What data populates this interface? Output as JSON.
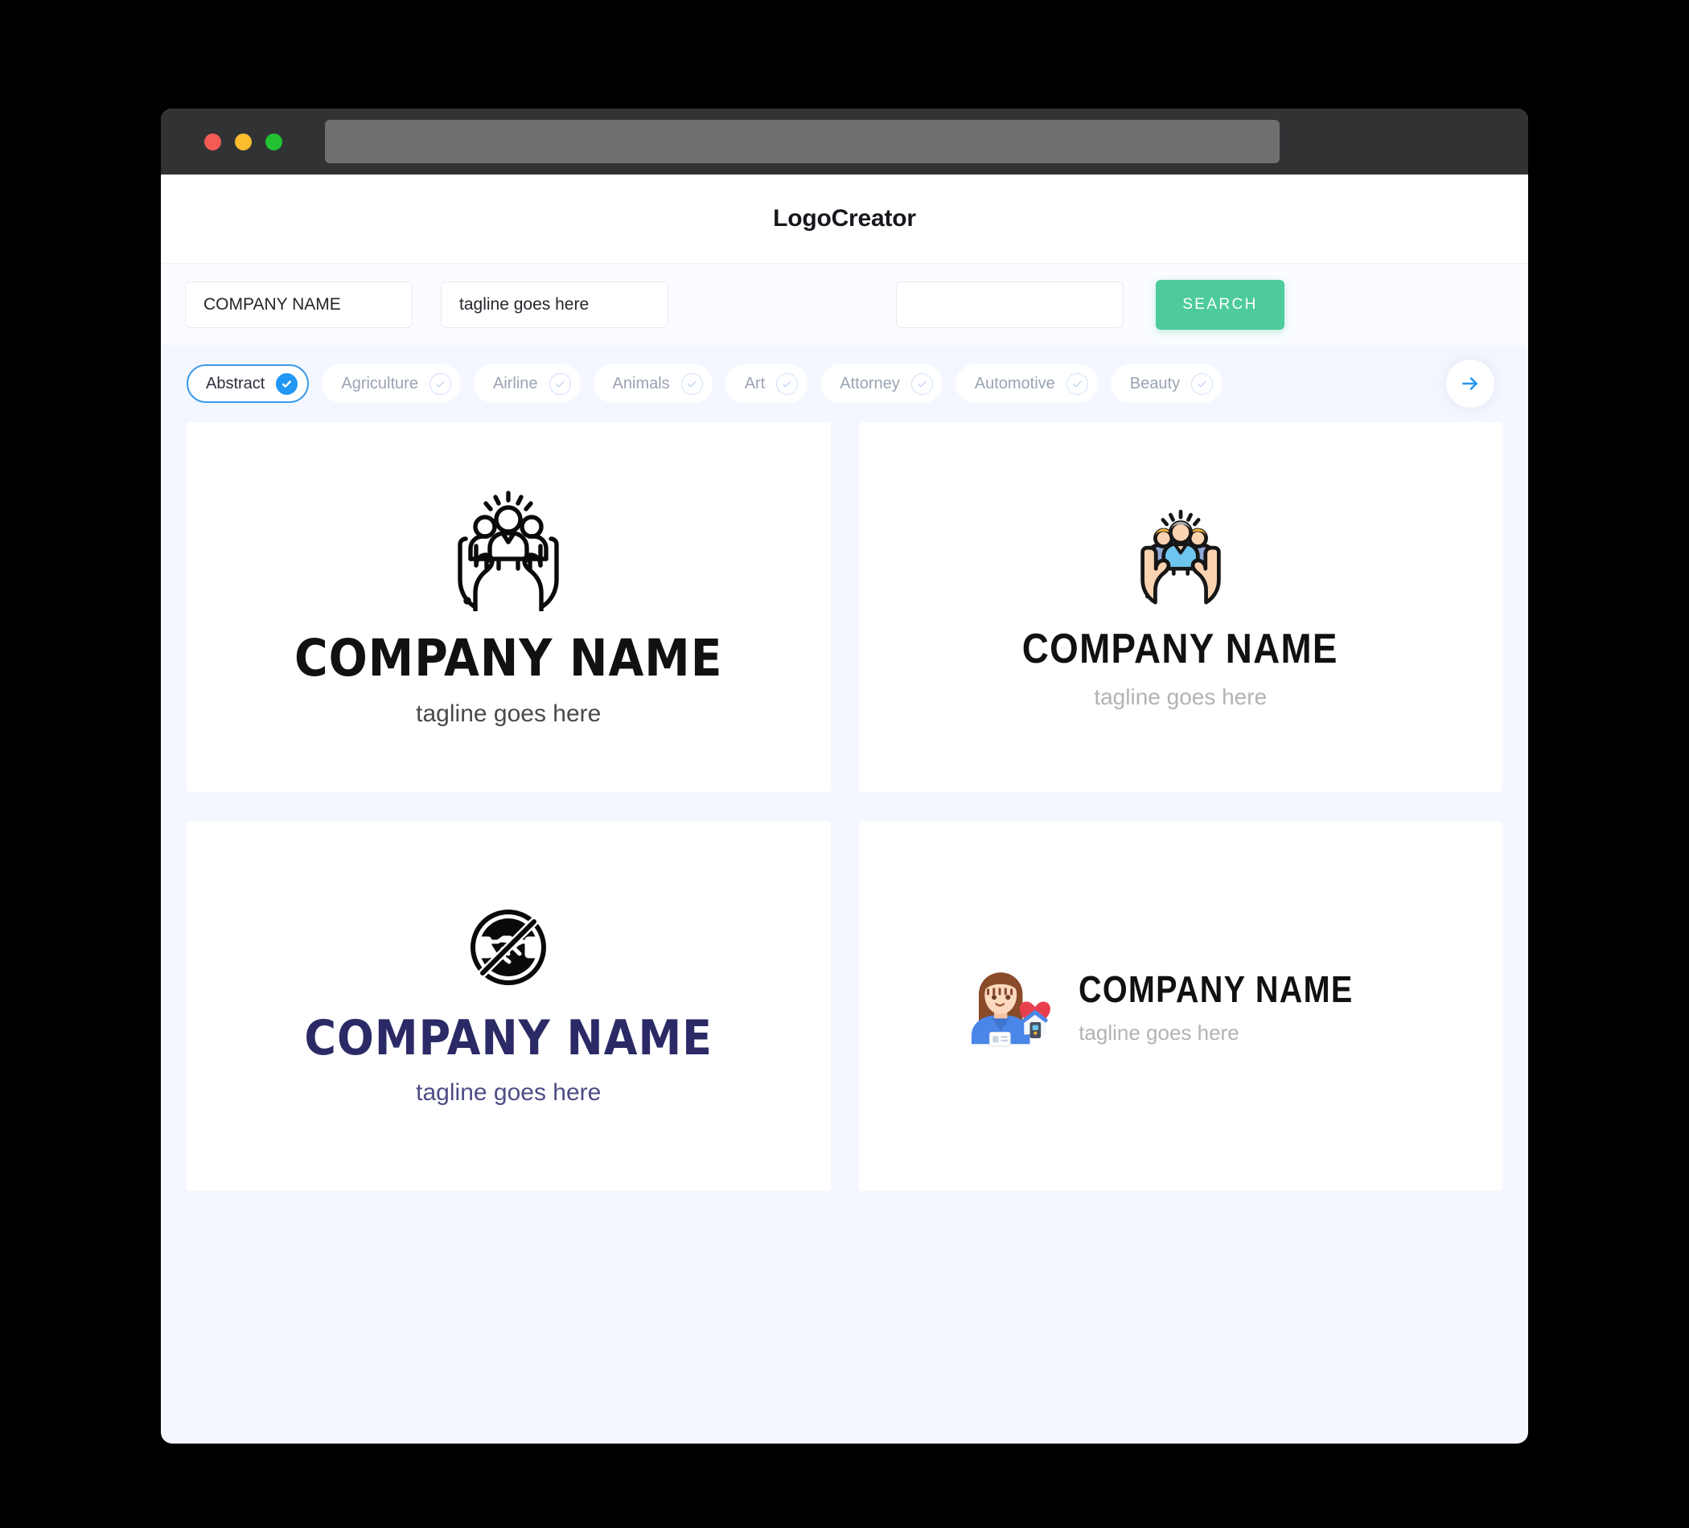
{
  "window": {
    "traffic_lights": [
      {
        "name": "close",
        "color": "#f45b53"
      },
      {
        "name": "minimize",
        "color": "#fbbc2e"
      },
      {
        "name": "maximize",
        "color": "#23c233"
      }
    ],
    "url_value": ""
  },
  "header": {
    "title": "LogoCreator"
  },
  "search": {
    "company_name_value": "COMPANY NAME",
    "company_name_placeholder": "COMPANY NAME",
    "tagline_value": "tagline goes here",
    "tagline_placeholder": "tagline goes here",
    "keyword_value": "",
    "keyword_placeholder": "",
    "search_label": "SEARCH",
    "search_color": "#4ecb9c"
  },
  "categories": {
    "next_icon": "arrow-right-icon",
    "accent": "#2196f3",
    "items": [
      {
        "label": "Abstract",
        "selected": true
      },
      {
        "label": "Agriculture",
        "selected": false
      },
      {
        "label": "Airline",
        "selected": false
      },
      {
        "label": "Animals",
        "selected": false
      },
      {
        "label": "Art",
        "selected": false
      },
      {
        "label": "Attorney",
        "selected": false
      },
      {
        "label": "Automotive",
        "selected": false
      },
      {
        "label": "Beauty",
        "selected": false
      }
    ]
  },
  "results": [
    {
      "icon": "hands-holding-people-outline-icon",
      "company_name": "COMPANY NAME",
      "tagline": "tagline goes here",
      "name_color": "#111111",
      "tagline_color": "#4a4a4a",
      "layout": "vertical"
    },
    {
      "icon": "hands-holding-people-color-icon",
      "company_name": "COMPANY NAME",
      "tagline": "tagline goes here",
      "name_color": "#111111",
      "tagline_color": "#b3b3b3",
      "layout": "vertical"
    },
    {
      "icon": "no-handshake-icon",
      "company_name": "COMPANY NAME",
      "tagline": "tagline goes here",
      "name_color": "#2b2a66",
      "tagline_color": "#4e4d86",
      "layout": "vertical"
    },
    {
      "icon": "nurse-home-care-heart-icon",
      "company_name": "COMPANY NAME",
      "tagline": "tagline goes here",
      "name_color": "#111111",
      "tagline_color": "#b3b3b3",
      "layout": "horizontal"
    }
  ]
}
